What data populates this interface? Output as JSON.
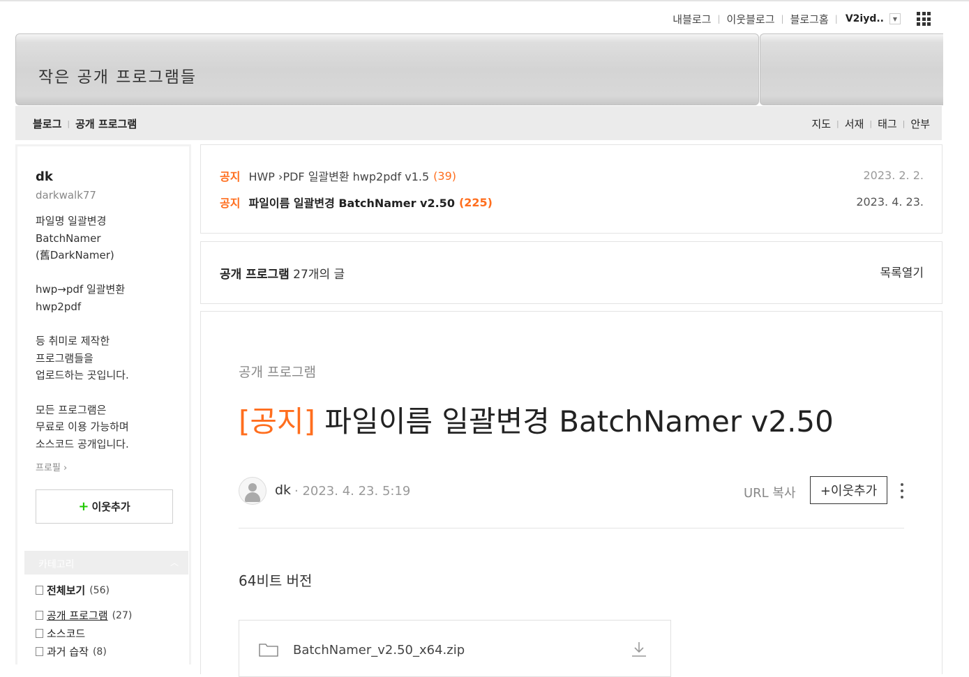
{
  "topbar": {
    "links": [
      "내블로그",
      "이웃블로그",
      "블로그홈"
    ],
    "username": "V2iyd.."
  },
  "banner": {
    "title": "작은 공개 프로그램들"
  },
  "nav": {
    "blog": "블로그",
    "category": "공개 프로그램",
    "right_links": [
      "지도",
      "서재",
      "태그",
      "안부"
    ]
  },
  "profile": {
    "name": "dk",
    "id": "darkwalk77",
    "description": "파일명 일괄변경\nBatchNamer\n(舊DarkNamer)\n\nhwp→pdf 일괄변환\nhwp2pdf\n\n등 취미로 제작한\n프로그램들을\n업로드하는 곳입니다.\n\n모든 프로그램은\n무료로 이용 가능하며\n소스코드 공개입니다.",
    "profile_link": "프로필",
    "add_neighbor": "이웃추가"
  },
  "categories": {
    "header": "카테고리",
    "items": [
      {
        "label": "전체보기",
        "count": "(56)"
      },
      {
        "label": "공개 프로그램",
        "count": "(27)"
      },
      {
        "label": "소스코드",
        "count": ""
      },
      {
        "label": "과거 습작",
        "count": "(8)"
      }
    ]
  },
  "notices": [
    {
      "tag": "공지",
      "title": "HWP  ›PDF 일괄변환 hwp2pdf v1.5",
      "count": "(39)",
      "date": "2023. 2. 2."
    },
    {
      "tag": "공지",
      "title": "파일이름 일괄변경 BatchNamer v2.50",
      "count": "(225)",
      "date": "2023. 4. 23."
    }
  ],
  "list": {
    "category": "공개 프로그램",
    "count_text": "27개의 글",
    "open_label": "목록열기"
  },
  "post": {
    "category": "공개 프로그램",
    "tag": "[공지]",
    "title": "파일이름 일괄변경 BatchNamer v2.50",
    "author": "dk",
    "date": "· 2023. 4. 23. 5:19",
    "url_copy": "URL 복사",
    "follow": "+이웃추가",
    "subtitle": "64비트 버전",
    "file_name": "BatchNamer_v2.50_x64.zip"
  },
  "colors": {
    "accent": "#ff6e1e",
    "green": "#1ec800"
  }
}
